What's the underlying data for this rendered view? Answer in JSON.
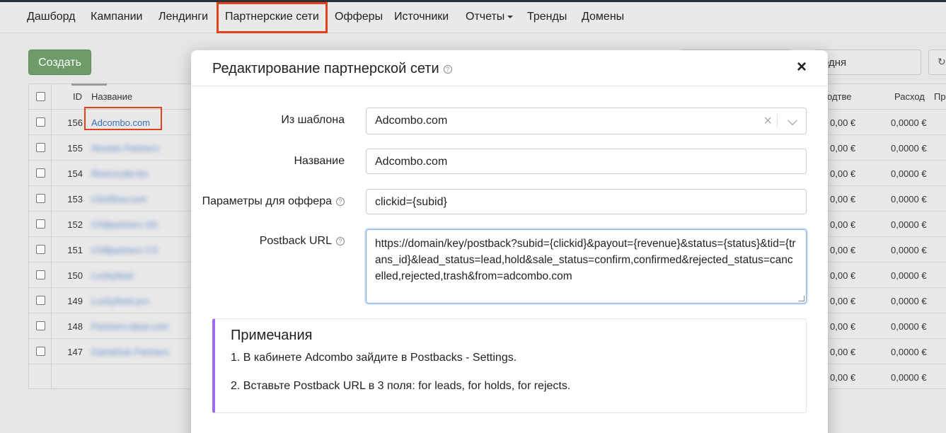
{
  "nav": {
    "items": [
      "Дашборд",
      "Кампании",
      "Лендинги",
      "Партнерские сети",
      "Офферы",
      "Источники",
      "Отчеты",
      "Тренды",
      "Домены"
    ]
  },
  "toolbar": {
    "create_label": "Создать",
    "date_value": "одня"
  },
  "table": {
    "headers": {
      "id": "ID",
      "name": "Название",
      "revenue": "одтве",
      "cost": "Расход",
      "extra": "Пр"
    },
    "rows": [
      {
        "id": "156",
        "name": "Adcombo.com",
        "revenue": "0,00 €",
        "cost": "0,0000 €"
      },
      {
        "id": "155",
        "name": "Alvotan Partners",
        "revenue": "0,00 €",
        "cost": "0,0000 €"
      },
      {
        "id": "154",
        "name": "Riverscale.biz",
        "revenue": "0,00 €",
        "cost": "0,0000 €"
      },
      {
        "id": "153",
        "name": "Clickflow.com",
        "revenue": "0,00 €",
        "cost": "0,0000 €"
      },
      {
        "id": "152",
        "name": "Chillpartners SS",
        "revenue": "0,00 €",
        "cost": "0,0000 €"
      },
      {
        "id": "151",
        "name": "Chillpartners CX",
        "revenue": "0,00 €",
        "cost": "0,0000 €"
      },
      {
        "id": "150",
        "name": "Luckyfeed",
        "revenue": "0,00 €",
        "cost": "0,0000 €"
      },
      {
        "id": "149",
        "name": "Luckyfeed.pro",
        "revenue": "0,00 €",
        "cost": "0,0000 €"
      },
      {
        "id": "148",
        "name": "Partners-ideal.com",
        "revenue": "0,00 €",
        "cost": "0,0000 €"
      },
      {
        "id": "147",
        "name": "Gamehub Partners",
        "revenue": "0,00 €",
        "cost": "0,0000 €"
      }
    ],
    "totals": {
      "revenue": "0,00 €",
      "cost": "0,0000 €"
    }
  },
  "modal": {
    "title": "Редактирование партнерской сети",
    "close": "×",
    "template_label": "Из шаблона",
    "template_value": "Adcombo.com",
    "template_clear": "×",
    "name_label": "Название",
    "name_value": "Adcombo.com",
    "params_label": "Параметры для оффера",
    "params_value": "clickid={subid}",
    "postback_label": "Postback URL",
    "postback_value": "https://domain/key/postback?subid={clickid}&payout={revenue}&status={status}&tid={trans_id}&lead_status=lead,hold&sale_status=confirm,confirmed&rejected_status=cancelled,rejected,trash&from=adcombo.com",
    "help": "?",
    "notes_title": "Примечания",
    "notes": [
      "1. В кабинете Adcombo зайдите в Postbacks - Settings.",
      "2. Вставьте Postback URL в 3 поля: for leads, for holds, for rejects."
    ]
  },
  "colors": {
    "accent_highlight": "#e0431b",
    "create_button": "#6e9b6a",
    "notes_border": "#9d6cf0",
    "link": "#3b6fb5"
  }
}
